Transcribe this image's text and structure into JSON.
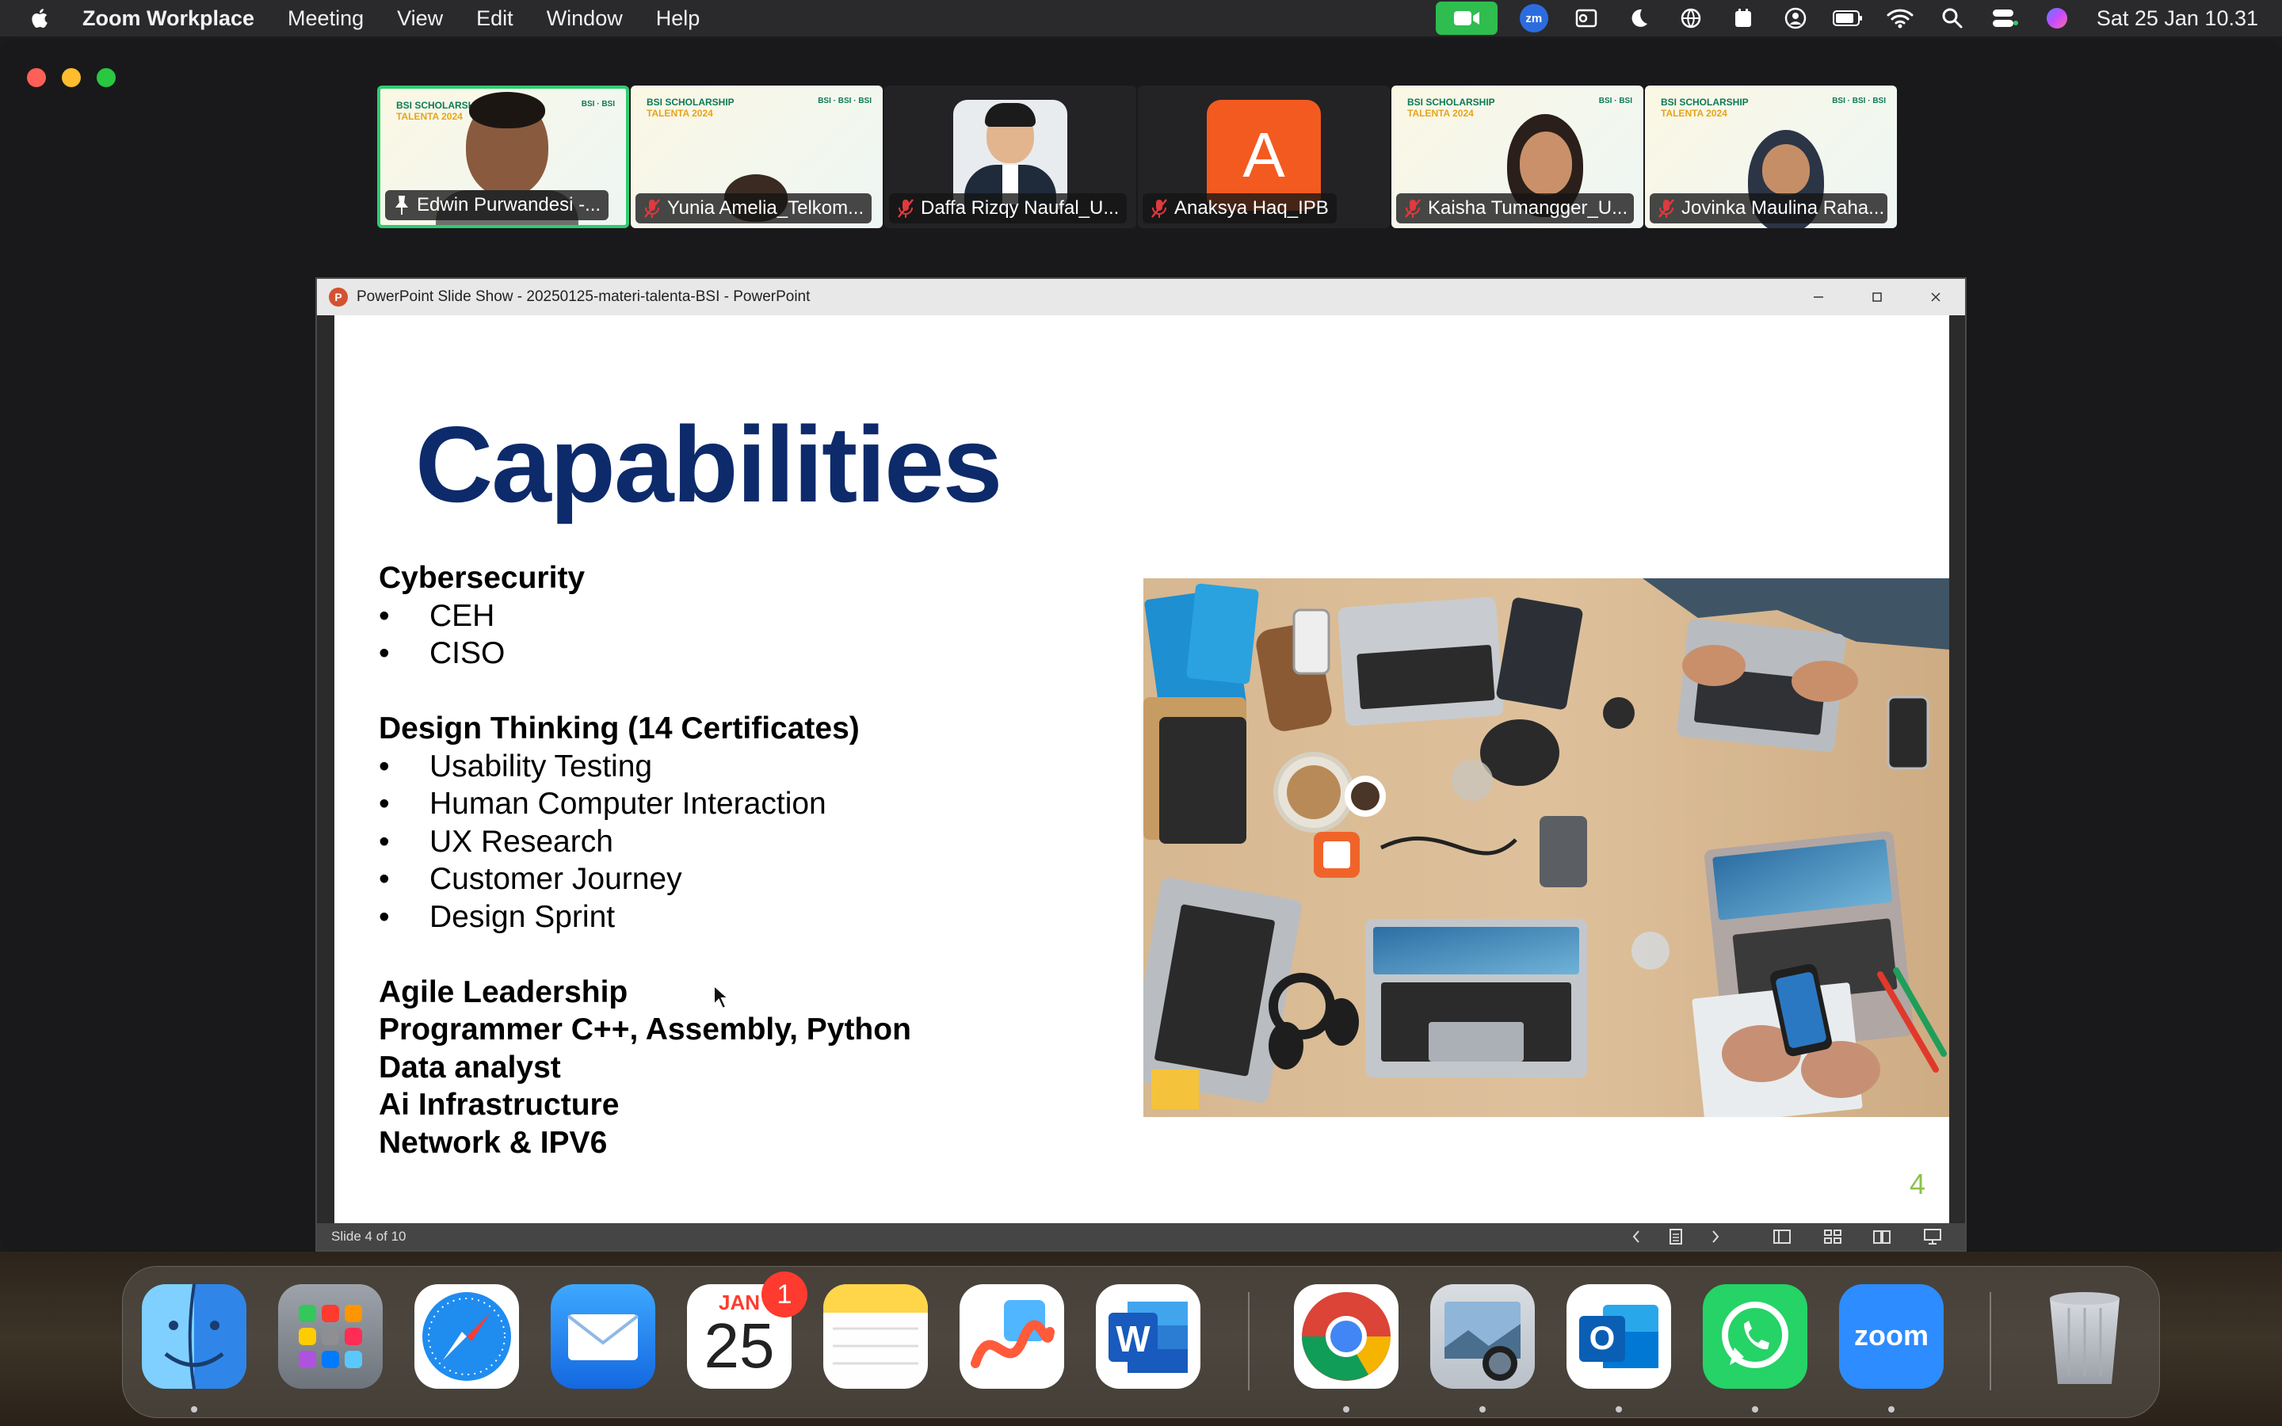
{
  "menubar": {
    "app_name": "Zoom Workplace",
    "menus": [
      "Meeting",
      "View",
      "Edit",
      "Window",
      "Help"
    ],
    "clock": "Sat 25 Jan  10.31",
    "zoom_badge": "zm"
  },
  "participants": [
    {
      "name": "Edwin Purwandesi -...",
      "active": true
    },
    {
      "name": "Yunia Amelia_Telkom...",
      "muted": true
    },
    {
      "name": "Daffa Rizqy Naufal_U...",
      "muted": true
    },
    {
      "name": "Anaksya Haq_IPB",
      "muted": true,
      "avatar_letter": "A"
    },
    {
      "name": "Kaisha Tumangger_U...",
      "muted": true
    },
    {
      "name": "Jovinka Maulina Raha...",
      "muted": true
    }
  ],
  "ppt": {
    "window_title": "PowerPoint Slide Show  -  20250125-materi-talenta-BSI  -  PowerPoint",
    "status": "Slide 4 of 10"
  },
  "slide": {
    "title": "Capabilities",
    "cybersecurity": {
      "heading": "Cybersecurity",
      "items": [
        "CEH",
        "CISO"
      ]
    },
    "design_thinking": {
      "heading": "Design Thinking (14 Certificates)",
      "items": [
        "Usability Testing",
        "Human Computer Interaction",
        "UX Research",
        "Customer Journey",
        "Design Sprint"
      ]
    },
    "extra": [
      "Agile Leadership",
      "Programmer C++, Assembly, Python",
      "Data analyst",
      "Ai Infrastructure",
      "Network & IPV6"
    ],
    "number": "4"
  },
  "dock": {
    "calendar_month": "JAN",
    "calendar_day": "25",
    "calendar_badge": "1",
    "word_letter": "W",
    "outlook_letter": "O",
    "zoom_label": "zoom"
  }
}
